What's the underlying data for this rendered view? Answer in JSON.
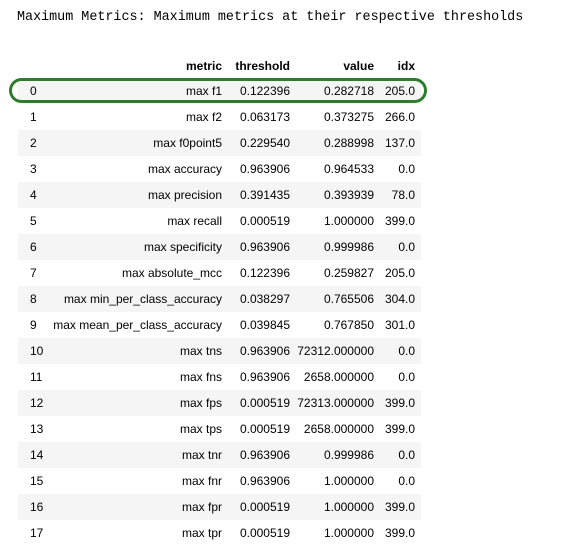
{
  "heading": "Maximum Metrics: Maximum metrics at their respective thresholds",
  "columns": {
    "index": "",
    "metric": "metric",
    "threshold": "threshold",
    "value": "value",
    "idx": "idx"
  },
  "highlight_color": "#2e7d2e",
  "rows": [
    {
      "index": "0",
      "metric": "max f1",
      "threshold": "0.122396",
      "value": "0.282718",
      "idx": "205.0"
    },
    {
      "index": "1",
      "metric": "max f2",
      "threshold": "0.063173",
      "value": "0.373275",
      "idx": "266.0"
    },
    {
      "index": "2",
      "metric": "max f0point5",
      "threshold": "0.229540",
      "value": "0.288998",
      "idx": "137.0"
    },
    {
      "index": "3",
      "metric": "max accuracy",
      "threshold": "0.963906",
      "value": "0.964533",
      "idx": "0.0"
    },
    {
      "index": "4",
      "metric": "max precision",
      "threshold": "0.391435",
      "value": "0.393939",
      "idx": "78.0"
    },
    {
      "index": "5",
      "metric": "max recall",
      "threshold": "0.000519",
      "value": "1.000000",
      "idx": "399.0"
    },
    {
      "index": "6",
      "metric": "max specificity",
      "threshold": "0.963906",
      "value": "0.999986",
      "idx": "0.0"
    },
    {
      "index": "7",
      "metric": "max absolute_mcc",
      "threshold": "0.122396",
      "value": "0.259827",
      "idx": "205.0"
    },
    {
      "index": "8",
      "metric": "max min_per_class_accuracy",
      "threshold": "0.038297",
      "value": "0.765506",
      "idx": "304.0"
    },
    {
      "index": "9",
      "metric": "max mean_per_class_accuracy",
      "threshold": "0.039845",
      "value": "0.767850",
      "idx": "301.0"
    },
    {
      "index": "10",
      "metric": "max tns",
      "threshold": "0.963906",
      "value": "72312.000000",
      "idx": "0.0"
    },
    {
      "index": "11",
      "metric": "max fns",
      "threshold": "0.963906",
      "value": "2658.000000",
      "idx": "0.0"
    },
    {
      "index": "12",
      "metric": "max fps",
      "threshold": "0.000519",
      "value": "72313.000000",
      "idx": "399.0"
    },
    {
      "index": "13",
      "metric": "max tps",
      "threshold": "0.000519",
      "value": "2658.000000",
      "idx": "399.0"
    },
    {
      "index": "14",
      "metric": "max tnr",
      "threshold": "0.963906",
      "value": "0.999986",
      "idx": "0.0"
    },
    {
      "index": "15",
      "metric": "max fnr",
      "threshold": "0.963906",
      "value": "1.000000",
      "idx": "0.0"
    },
    {
      "index": "16",
      "metric": "max fpr",
      "threshold": "0.000519",
      "value": "1.000000",
      "idx": "399.0"
    },
    {
      "index": "17",
      "metric": "max tpr",
      "threshold": "0.000519",
      "value": "1.000000",
      "idx": "399.0"
    }
  ]
}
